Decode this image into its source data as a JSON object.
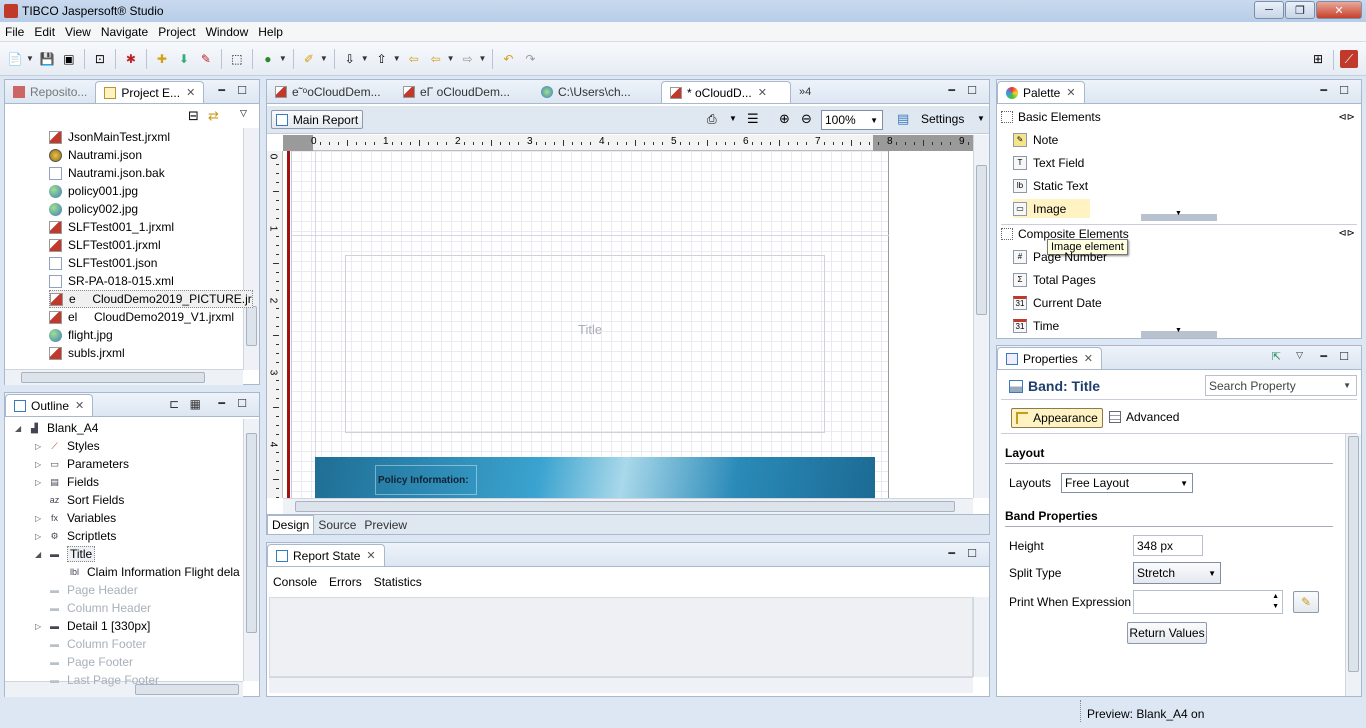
{
  "window": {
    "title": "TIBCO Jaspersoft® Studio",
    "buttons": {
      "minimize": "─",
      "maximize": "❐",
      "close": "✕"
    }
  },
  "menu": [
    "File",
    "Edit",
    "View",
    "Navigate",
    "Project",
    "Window",
    "Help"
  ],
  "project_explorer": {
    "tabs": [
      {
        "label": "Reposito...",
        "icon": "repository-icon"
      },
      {
        "label": "Project E...",
        "icon": "project-explorer-icon"
      }
    ],
    "items": [
      {
        "label": "JsonMainTest.jrxml",
        "type": "jrxml"
      },
      {
        "label": "Nautrami.json",
        "type": "json"
      },
      {
        "label": "Nautrami.json.bak",
        "type": "file"
      },
      {
        "label": "policy001.jpg",
        "type": "image"
      },
      {
        "label": "policy002.jpg",
        "type": "image"
      },
      {
        "label": "SLFTest001_1.jrxml",
        "type": "jrxml"
      },
      {
        "label": "SLFTest001.jrxml",
        "type": "jrxml"
      },
      {
        "label": "SLFTest001.json",
        "type": "file"
      },
      {
        "label": "SR-PA-018-015.xml",
        "type": "file"
      },
      {
        "label": "e     CloudDemo2019_PICTURE.jr",
        "type": "jrxml"
      },
      {
        "label": "el     CloudDemo2019_V1.jrxml",
        "type": "jrxml"
      },
      {
        "label": "flight.jpg",
        "type": "image"
      },
      {
        "label": "subls.jrxml",
        "type": "jrxml"
      }
    ]
  },
  "outline": {
    "tab": "Outline",
    "items": [
      {
        "label": "Blank_A4",
        "level": 0,
        "expander": "◢",
        "grey": false,
        "icon": "report-icon"
      },
      {
        "label": "Styles",
        "level": 1,
        "expander": "▷",
        "grey": false,
        "icon": "styles-icon"
      },
      {
        "label": "Parameters",
        "level": 1,
        "expander": "▷",
        "grey": false,
        "icon": "parameters-icon"
      },
      {
        "label": "Fields",
        "level": 1,
        "expander": "▷",
        "grey": false,
        "icon": "fields-icon"
      },
      {
        "label": "Sort Fields",
        "level": 1,
        "expander": "",
        "grey": false,
        "icon": "sort-fields-icon"
      },
      {
        "label": "Variables",
        "level": 1,
        "expander": "▷",
        "grey": false,
        "icon": "variables-icon"
      },
      {
        "label": "Scriptlets",
        "level": 1,
        "expander": "▷",
        "grey": false,
        "icon": "scriptlets-icon"
      },
      {
        "label": "Title",
        "level": 1,
        "expander": "◢",
        "grey": false,
        "icon": "band-icon"
      },
      {
        "label": "Claim Information Flight dela",
        "level": 2,
        "expander": "",
        "grey": false,
        "icon": "label-icon"
      },
      {
        "label": "Page Header",
        "level": 1,
        "expander": "",
        "grey": true,
        "icon": "band-icon"
      },
      {
        "label": "Column Header",
        "level": 1,
        "expander": "",
        "grey": true,
        "icon": "band-icon"
      },
      {
        "label": "Detail 1 [330px]",
        "level": 1,
        "expander": "▷",
        "grey": false,
        "icon": "band-icon"
      },
      {
        "label": "Column Footer",
        "level": 1,
        "expander": "",
        "grey": true,
        "icon": "band-icon"
      },
      {
        "label": "Page Footer",
        "level": 1,
        "expander": "",
        "grey": true,
        "icon": "band-icon"
      },
      {
        "label": "Last Page Footer",
        "level": 1,
        "expander": "",
        "grey": true,
        "icon": "band-icon"
      }
    ]
  },
  "editor": {
    "tabs": [
      {
        "label": "e˜ᵒoCloudDem...",
        "active": false
      },
      {
        "label": "eΓ  oCloudDem...",
        "active": false
      },
      {
        "label": "C:\\Users\\ch...",
        "active": false
      },
      {
        "label": "*      oCloudD...",
        "active": true
      }
    ],
    "overflow": "»4",
    "main_report": "Main Report",
    "zoom": "100%",
    "settings": "Settings",
    "ruler_labels": [
      "0",
      "1",
      "2",
      "3",
      "4",
      "5",
      "6",
      "7",
      "8",
      "9"
    ],
    "vruler_labels": [
      "0",
      "1",
      "2",
      "3",
      "4"
    ],
    "band_title": "Title",
    "policy_label": "Policy Information:",
    "bottom_tabs": [
      "Design",
      "Source",
      "Preview"
    ]
  },
  "report_state": {
    "tab": "Report State",
    "tabs": [
      "Console",
      "Errors",
      "Statistics"
    ]
  },
  "palette": {
    "tab": "Palette",
    "basic_header": "Basic Elements",
    "basic": [
      {
        "label": "Note",
        "icon": "note-icon"
      },
      {
        "label": "Text Field",
        "icon": "text-field-icon"
      },
      {
        "label": "Static Text",
        "icon": "static-text-icon"
      },
      {
        "label": "Image",
        "icon": "image-icon"
      }
    ],
    "composite_header": "Composite Elements",
    "composite": [
      {
        "label": "Page Number",
        "icon": "page-number-icon"
      },
      {
        "label": "Total Pages",
        "icon": "total-pages-icon"
      },
      {
        "label": "Current Date",
        "icon": "calendar-icon"
      },
      {
        "label": "Time",
        "icon": "calendar-icon"
      }
    ],
    "tooltip": "Image element"
  },
  "properties": {
    "tab": "Properties",
    "heading": "Band: Title",
    "search_placeholder": "Search Property",
    "tabs": [
      "Appearance",
      "Advanced"
    ],
    "layout_section": "Layout",
    "layouts_label": "Layouts",
    "layouts_value": "Free Layout",
    "band_section": "Band Properties",
    "height_label": "Height",
    "height_value": "348 px",
    "split_label": "Split Type",
    "split_value": "Stretch",
    "print_when_label": "Print When Expression",
    "return_values": "Return Values"
  },
  "status": {
    "text": "Preview: Blank_A4 on"
  },
  "colors": {
    "accent": "#3a7bbf",
    "band_bg": "#2a8ab8",
    "selection": "#fff3c4"
  }
}
